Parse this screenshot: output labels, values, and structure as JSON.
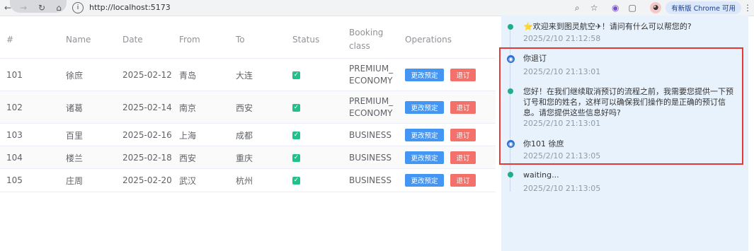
{
  "browser": {
    "url": "http://localhost:5173",
    "update_label": "有新版 Chrome 可用",
    "menu_glyph": "⋮",
    "icons": [
      "back-icon",
      "forward-icon",
      "reload-icon",
      "home-icon",
      "info-icon",
      "zoom-icon",
      "star-icon",
      "extension-icon",
      "puzzle-icon",
      "profile-icon",
      "menu-icon"
    ]
  },
  "table": {
    "headers": {
      "id": "#",
      "name": "Name",
      "date": "Date",
      "from": "From",
      "to": "To",
      "status": "Status",
      "booking_class": "Booking class",
      "operations": "Operations"
    },
    "rows": [
      {
        "id": "101",
        "name": "徐庶",
        "date": "2025-02-12",
        "from": "青岛",
        "to": "大连",
        "status": true,
        "booking_class": "PREMIUM_ ECONOMY",
        "change": "更改预定",
        "cancel": "退订"
      },
      {
        "id": "102",
        "name": "诸葛",
        "date": "2025-02-14",
        "from": "南京",
        "to": "西安",
        "status": true,
        "booking_class": "PREMIUM_ ECONOMY",
        "change": "更改预定",
        "cancel": "退订"
      },
      {
        "id": "103",
        "name": "百里",
        "date": "2025-02-16",
        "from": "上海",
        "to": "成都",
        "status": true,
        "booking_class": "BUSINESS",
        "change": "更改预定",
        "cancel": "退订"
      },
      {
        "id": "104",
        "name": "楼兰",
        "date": "2025-02-18",
        "from": "西安",
        "to": "重庆",
        "status": true,
        "booking_class": "BUSINESS",
        "change": "更改预定",
        "cancel": "退订"
      },
      {
        "id": "105",
        "name": "庄周",
        "date": "2025-02-20",
        "from": "武汉",
        "to": "杭州",
        "status": true,
        "booking_class": "BUSINESS",
        "change": "更改预定",
        "cancel": "退订"
      }
    ]
  },
  "chat": {
    "messages": [
      {
        "role": "assistant",
        "text": "⭐欢迎来到图灵航空✈！请问有什么可以帮您的?",
        "time": "2025/2/10 21:12:58"
      },
      {
        "role": "user",
        "text": "你退订",
        "time": "2025/2/10 21:13:01"
      },
      {
        "role": "assistant",
        "text": "您好！在我们继续取消预订的流程之前，我需要您提供一下预订号和您的姓名，这样可以确保我们操作的是正确的预订信息。请您提供这些信息好吗?",
        "time": "2025/2/10 21:13:01"
      },
      {
        "role": "user",
        "text": "你101 徐庶",
        "time": "2025/2/10 21:13:05"
      },
      {
        "role": "assistant",
        "text": "waiting...",
        "time": "2025/2/10 21:13:05"
      }
    ]
  },
  "colors": {
    "check_green": "#22c08a",
    "change_button": "#4496f2",
    "cancel_button": "#f2716a",
    "chat_background": "#e8f2fd",
    "highlight_border": "#e53935"
  }
}
